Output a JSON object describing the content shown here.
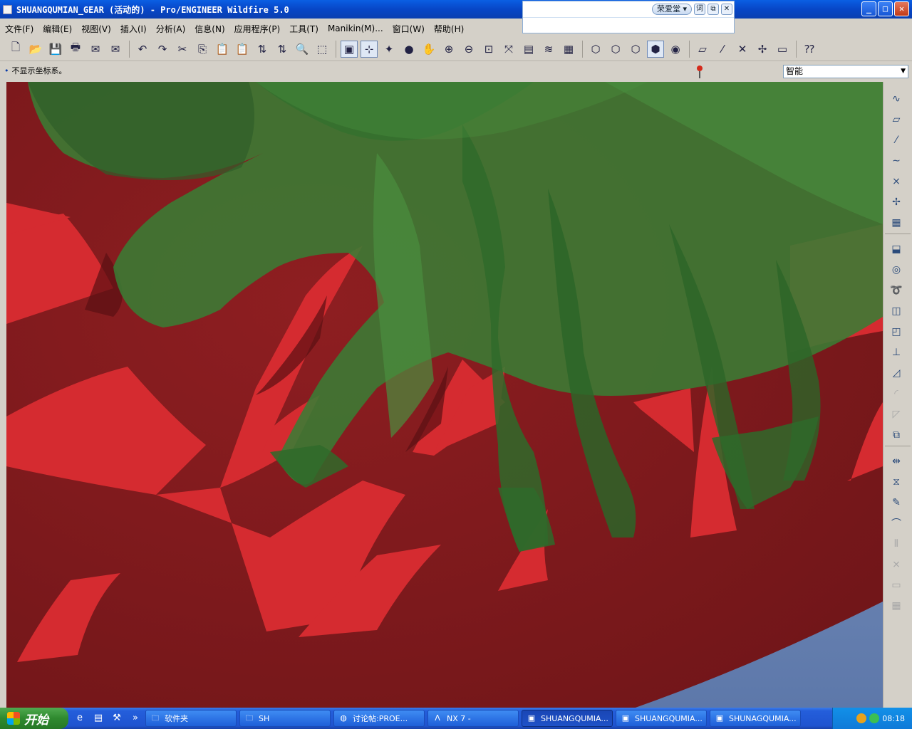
{
  "window": {
    "title": "SHUANGQUMIAN_GEAR (活动的) - Pro/ENGINEER Wildfire 5.0",
    "minimize": "_",
    "maximize": "□",
    "close": "✕"
  },
  "ime": {
    "name": "荣爱堂 ▾",
    "word_btn": "词",
    "restore": "⧉",
    "close": "✕"
  },
  "menu": [
    "文件(F)",
    "编辑(E)",
    "视图(V)",
    "插入(I)",
    "分析(A)",
    "信息(N)",
    "应用程序(P)",
    "工具(T)",
    "Manikin(M)...",
    "窗口(W)",
    "帮助(H)"
  ],
  "toolbar": {
    "file_group": [
      "new-icon",
      "open-icon",
      "save-icon",
      "print-icon",
      "email-icon",
      "email-attach-icon"
    ],
    "edit_group": [
      "undo-icon",
      "redo-icon",
      "cut-icon",
      "copy-icon",
      "paste-icon",
      "paste-special-icon",
      "regenerate-icon",
      "regen-manager-icon",
      "find-icon",
      "select-box-icon"
    ],
    "view_group": [
      "view-manager-icon",
      "datum-display-icon",
      "spin-center-icon",
      "appearance-icon",
      "pan-icon",
      "zoom-in-icon",
      "zoom-out-icon",
      "refit-icon",
      "reorient-icon",
      "saved-views-icon",
      "layers-icon",
      "model-tree-icon"
    ],
    "display_group": [
      "wireframe-icon",
      "hidden-line-icon",
      "no-hidden-icon",
      "shading-icon",
      "enhanced-realism-icon"
    ],
    "datum_group": [
      "datum-planes-icon",
      "datum-axes-icon",
      "datum-points-icon",
      "datum-csys-icon",
      "annotation-icon"
    ],
    "help_icon": "context-help-icon"
  },
  "status": {
    "message": "不显示坐标系。",
    "filter_value": "智能"
  },
  "right_toolbar": [
    {
      "icon": "sketch-icon",
      "dim": false
    },
    {
      "icon": "datum-plane-icon",
      "dim": false
    },
    {
      "icon": "datum-axis-icon",
      "dim": false
    },
    {
      "icon": "datum-curve-icon",
      "dim": false
    },
    {
      "icon": "datum-point-icon",
      "dim": false
    },
    {
      "icon": "datum-csys-icon",
      "dim": false
    },
    {
      "icon": "analysis-feature-icon",
      "dim": false
    },
    {
      "icon": "extrude-icon",
      "dim": false
    },
    {
      "icon": "revolve-icon",
      "dim": false
    },
    {
      "icon": "sweep-icon",
      "dim": false
    },
    {
      "icon": "hole-icon",
      "dim": false
    },
    {
      "icon": "shell-icon",
      "dim": false
    },
    {
      "icon": "rib-icon",
      "dim": false
    },
    {
      "icon": "draft-icon",
      "dim": false
    },
    {
      "icon": "round-icon",
      "dim": true
    },
    {
      "icon": "chamfer-icon",
      "dim": true
    },
    {
      "icon": "pattern-icon",
      "dim": false
    },
    {
      "icon": "mirror-icon",
      "dim": false
    },
    {
      "icon": "merge-icon",
      "dim": false
    },
    {
      "icon": "trim-icon",
      "dim": false
    },
    {
      "icon": "extend-icon",
      "dim": false
    },
    {
      "icon": "offset-icon",
      "dim": true
    },
    {
      "icon": "intersect-icon",
      "dim": true
    },
    {
      "icon": "thicken-icon",
      "dim": true
    },
    {
      "icon": "solidify-icon",
      "dim": true
    }
  ],
  "taskbar": {
    "start_label": "开始",
    "quicklaunch": [
      "ie-icon",
      "notepad-icon",
      "tool-icon"
    ],
    "more": "»",
    "tasks": [
      {
        "label": "软件夹",
        "icon": "folder-icon",
        "active": false
      },
      {
        "label": "SH",
        "icon": "folder-icon",
        "active": false
      },
      {
        "label": "讨论帖:PROE...",
        "icon": "browser-icon",
        "active": false
      },
      {
        "label": "NX 7 -",
        "icon": "nx-icon",
        "active": false
      },
      {
        "label": "SHUANGQUMIA...",
        "icon": "proe-icon",
        "active": true
      },
      {
        "label": "SHUANGQUMIA...",
        "icon": "proe-icon",
        "active": false
      },
      {
        "label": "SHUNAGQUMIA...",
        "icon": "proe-icon",
        "active": false
      }
    ],
    "clock": "08:18"
  },
  "colors": {
    "gear_red_dark": "#7c191b",
    "gear_red_bright": "#d52b30",
    "gear_green": "#3a7c34",
    "background_blue": "#6d86b4"
  }
}
